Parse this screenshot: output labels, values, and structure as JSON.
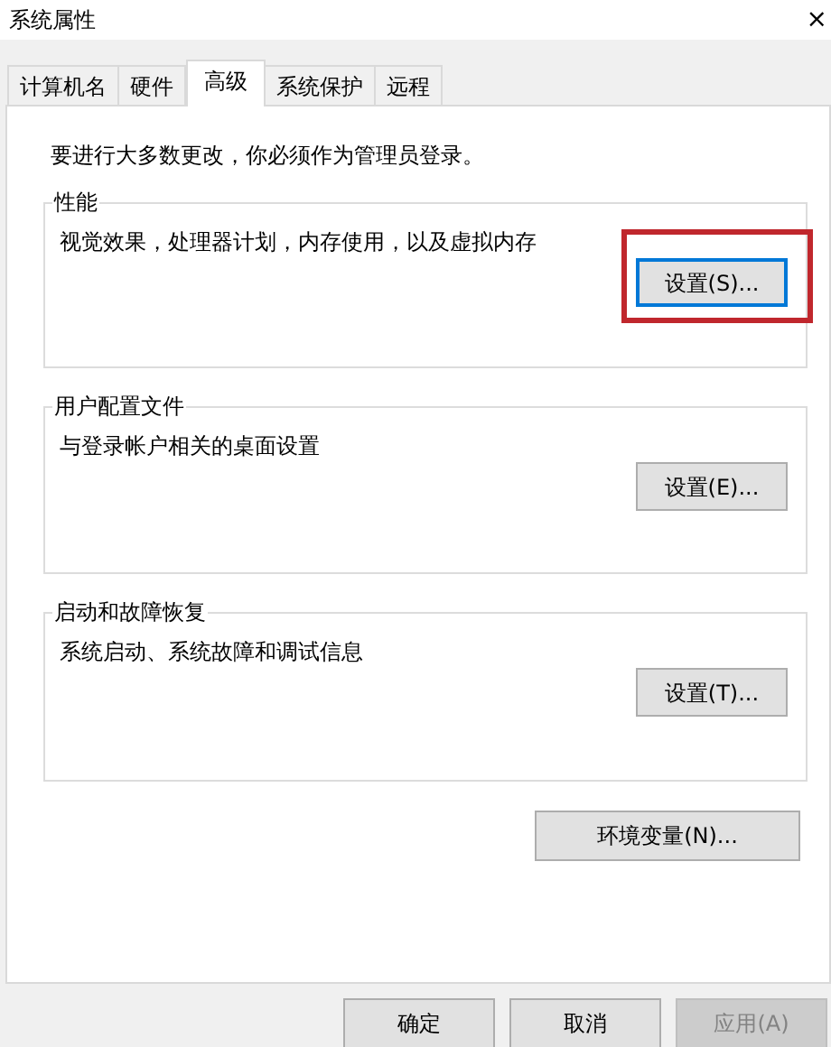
{
  "window": {
    "title": "系统属性",
    "close": "×"
  },
  "tabs": [
    {
      "label": "计算机名",
      "selected": false
    },
    {
      "label": "硬件",
      "selected": false
    },
    {
      "label": "高级",
      "selected": true
    },
    {
      "label": "系统保护",
      "selected": false
    },
    {
      "label": "远程",
      "selected": false
    }
  ],
  "notice": "要进行大多数更改，你必须作为管理员登录。",
  "groups": [
    {
      "title": "性能",
      "description": "视觉效果，处理器计划，内存使用，以及虚拟内存",
      "button": {
        "label": "设置(S)...",
        "focused": true,
        "highlighted": true
      }
    },
    {
      "title": "用户配置文件",
      "description": "与登录帐户相关的桌面设置",
      "button": {
        "label": "设置(E)...",
        "focused": false,
        "highlighted": false
      }
    },
    {
      "title": "启动和故障恢复",
      "description": "系统启动、系统故障和调试信息",
      "button": {
        "label": "设置(T)...",
        "focused": false,
        "highlighted": false
      }
    }
  ],
  "env_button": "环境变量(N)...",
  "footer_buttons": [
    {
      "label": "确定",
      "disabled": false
    },
    {
      "label": "取消",
      "disabled": false
    },
    {
      "label": "应用(A)",
      "disabled": true
    }
  ]
}
